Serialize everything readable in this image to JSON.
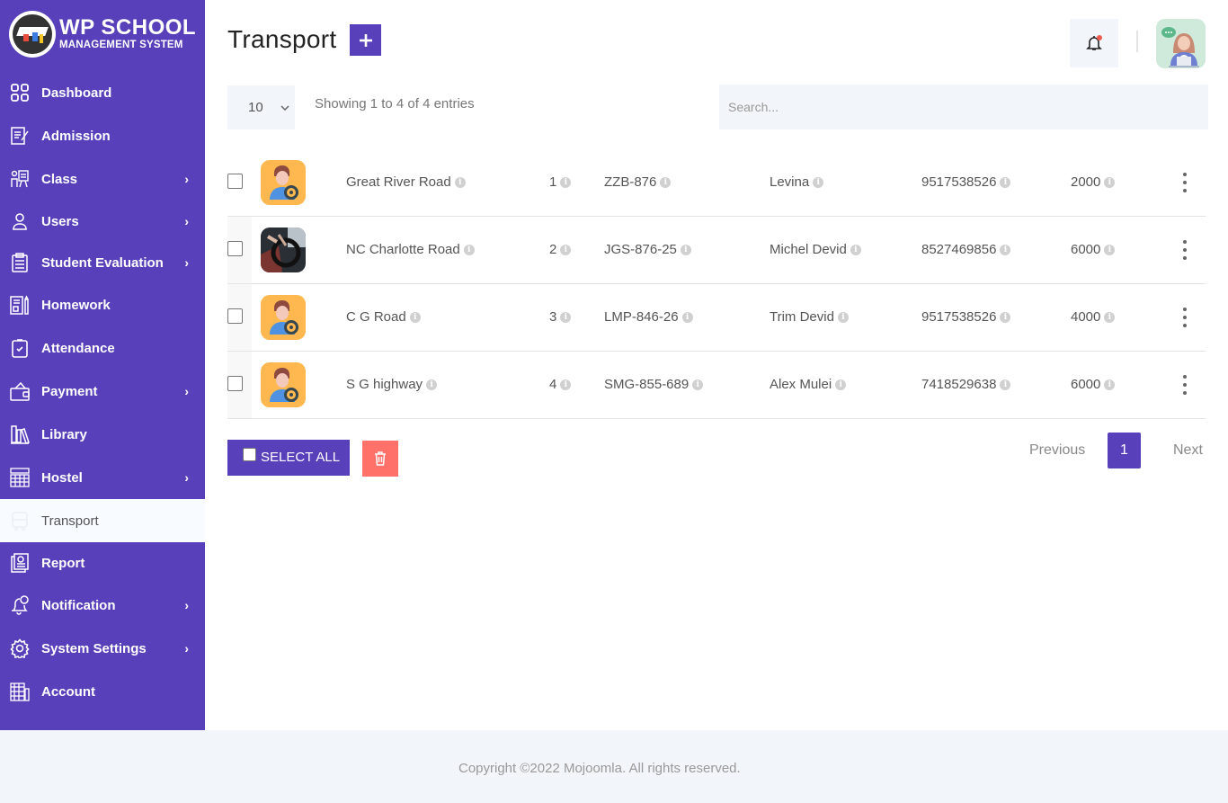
{
  "brand": {
    "title": "WP SCHOOL",
    "subtitle": "MANAGEMENT SYSTEM"
  },
  "sidebar": {
    "items": [
      {
        "label": "Dashboard",
        "icon": "grid-icon",
        "has_submenu": false
      },
      {
        "label": "Admission",
        "icon": "form-edit-icon",
        "has_submenu": false
      },
      {
        "label": "Class",
        "icon": "teacher-board-icon",
        "has_submenu": true
      },
      {
        "label": "Users",
        "icon": "user-icon",
        "has_submenu": true
      },
      {
        "label": "Student Evaluation",
        "icon": "clipboard-list-icon",
        "has_submenu": true
      },
      {
        "label": "Homework",
        "icon": "notebook-pencil-icon",
        "has_submenu": false
      },
      {
        "label": "Attendance",
        "icon": "clipboard-check-icon",
        "has_submenu": false
      },
      {
        "label": "Payment",
        "icon": "wallet-icon",
        "has_submenu": true
      },
      {
        "label": "Library",
        "icon": "books-icon",
        "has_submenu": false
      },
      {
        "label": "Hostel",
        "icon": "building-icon",
        "has_submenu": true
      },
      {
        "label": "Transport",
        "icon": "bus-icon",
        "has_submenu": false,
        "active": true
      },
      {
        "label": "Report",
        "icon": "report-icon",
        "has_submenu": false
      },
      {
        "label": "Notification",
        "icon": "bell-badge-icon",
        "has_submenu": true
      },
      {
        "label": "System Settings",
        "icon": "gear-icon",
        "has_submenu": true
      },
      {
        "label": "Account",
        "icon": "account-icon",
        "has_submenu": false
      }
    ],
    "chevron": "›"
  },
  "header": {
    "title": "Transport",
    "add_button": "+",
    "notification_icon": "bell-icon",
    "avatar": "support-agent-avatar"
  },
  "table_controls": {
    "page_length": "10",
    "info": "Showing 1 to 4 of 4 entries",
    "search_placeholder": "Search..."
  },
  "table": {
    "rows": [
      {
        "route": "Great River Road",
        "number": "1",
        "vehicle": "ZZB-876",
        "driver": "Levina",
        "phone": "9517538526",
        "fare": "2000",
        "image": "driver-avatar"
      },
      {
        "route": "NC Charlotte Road",
        "number": "2",
        "vehicle": "JGS-876-25",
        "driver": "Michel Devid",
        "phone": "8527469856",
        "fare": "6000",
        "image": "driver-photo"
      },
      {
        "route": "C G Road",
        "number": "3",
        "vehicle": "LMP-846-26",
        "driver": "Trim Devid",
        "phone": "9517538526",
        "fare": "4000",
        "image": "driver-avatar"
      },
      {
        "route": "S G highway",
        "number": "4",
        "vehicle": "SMG-855-689",
        "driver": "Alex Mulei",
        "phone": "7418529638",
        "fare": "6000",
        "image": "driver-avatar"
      }
    ],
    "info_glyph": "i"
  },
  "actions": {
    "select_all": "SELECT ALL",
    "delete_icon": "trash-icon"
  },
  "pagination": {
    "previous": "Previous",
    "current": "1",
    "next": "Next"
  },
  "footer": {
    "copyright": "Copyright ©2022 Mojoomla. All rights reserved."
  },
  "colors": {
    "primary": "#5840bb",
    "danger": "#ff7169",
    "surface": "#f2f5fa"
  }
}
